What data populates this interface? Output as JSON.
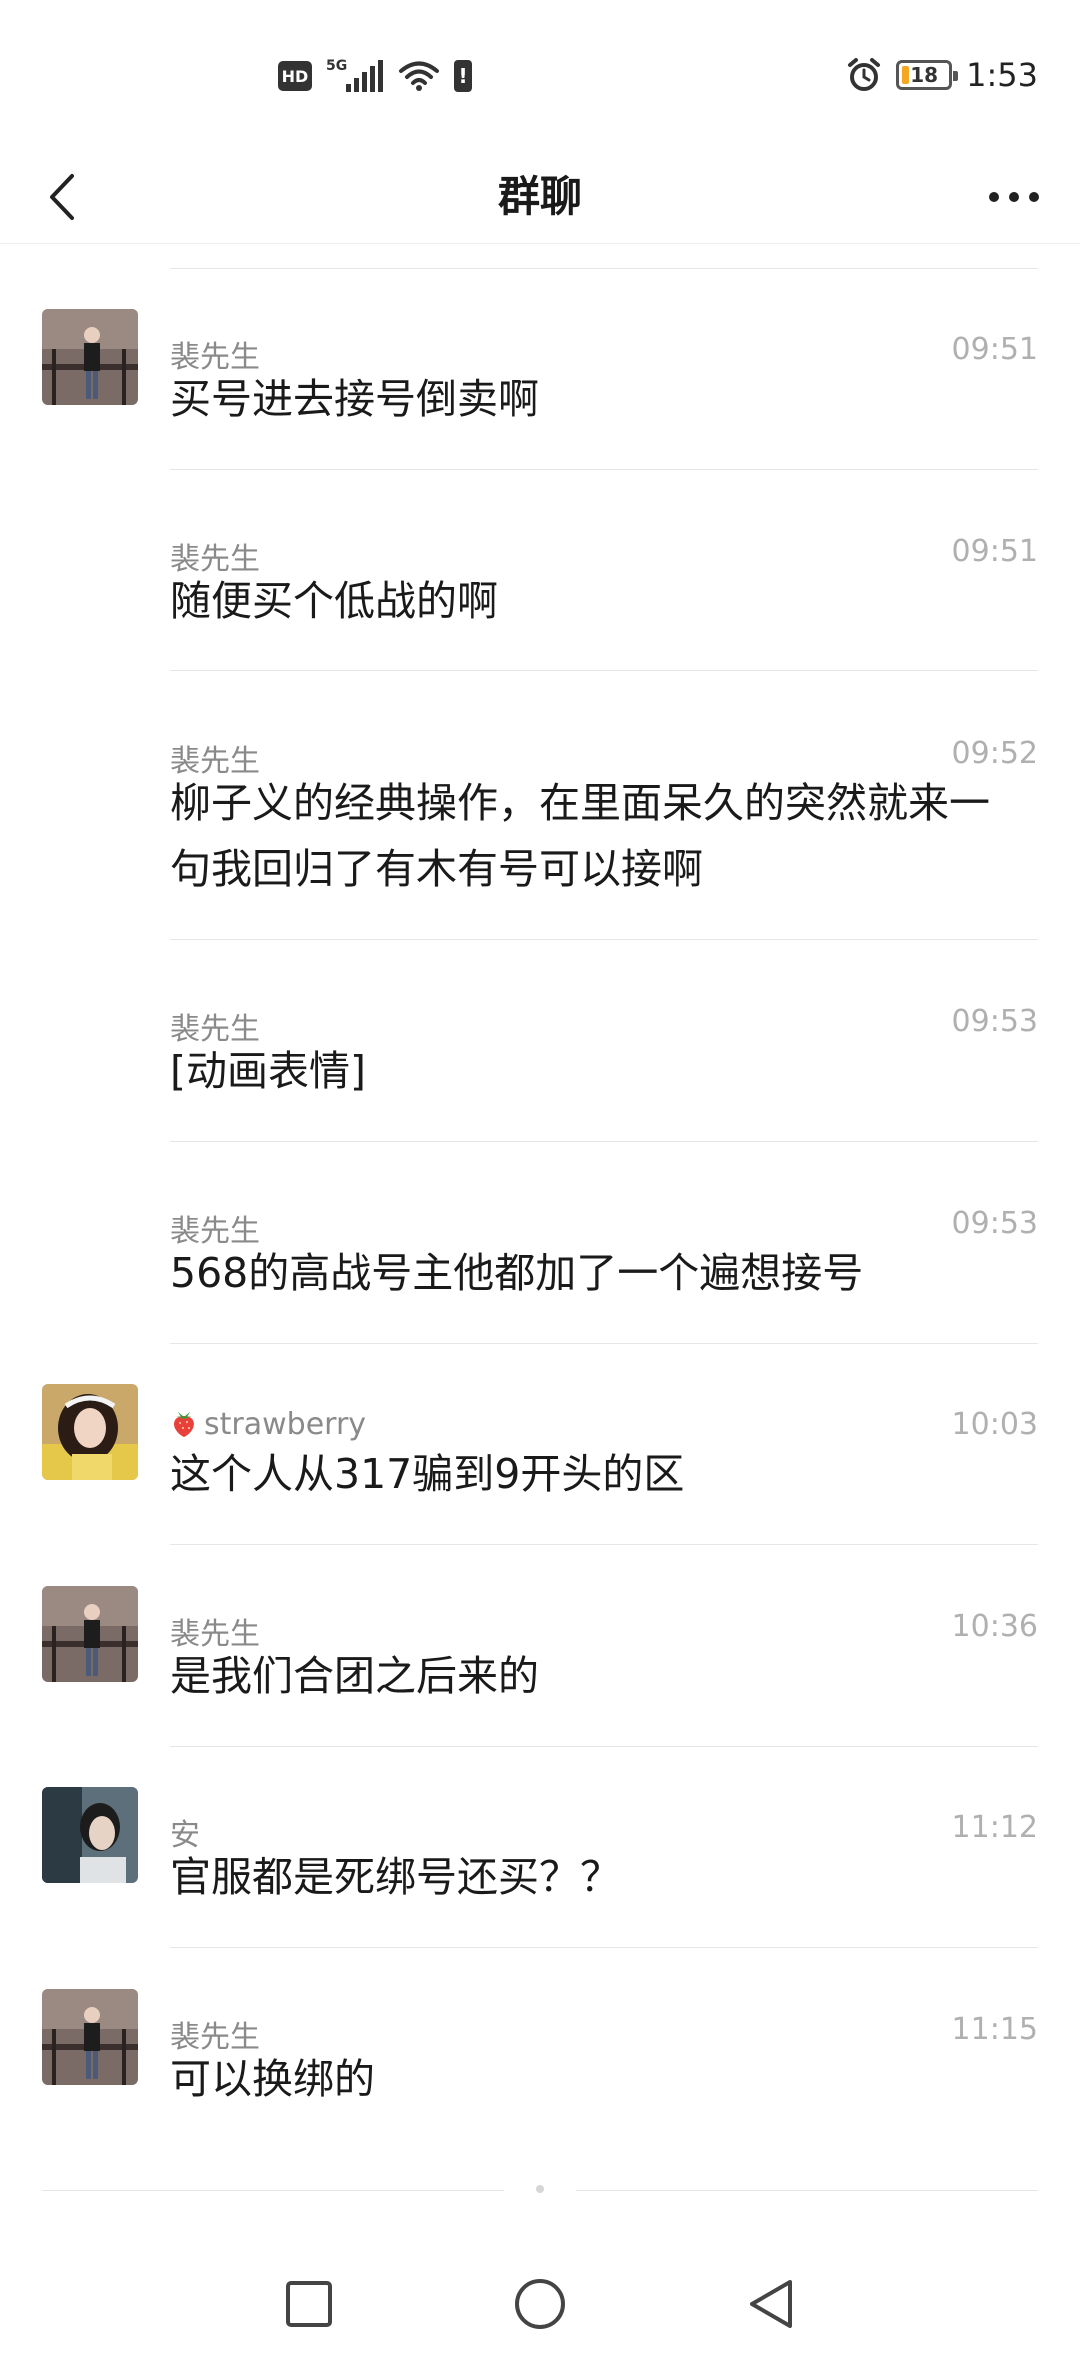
{
  "status_bar": {
    "hd": "HD",
    "network": "5G",
    "battery_level": "18",
    "time": "1:53",
    "icons": [
      "hd-icon",
      "signal-icon",
      "wifi-icon",
      "alert-icon",
      "alarm-icon",
      "battery-icon"
    ]
  },
  "header": {
    "title": "群聊",
    "back_icon": "chevron-left-icon",
    "more_icon": "more-dots-icon"
  },
  "messages": [
    {
      "sender": "裴先生",
      "time": "09:51",
      "text": "买号进去接号倒卖啊",
      "avatar": "avatar-pei"
    },
    {
      "sender": "裴先生",
      "time": "09:51",
      "text": "随便买个低战的啊",
      "avatar": ""
    },
    {
      "sender": "裴先生",
      "time": "09:52",
      "text": "柳子义的经典操作，在里面呆久的突然就来一句我回归了有木有号可以接啊",
      "avatar": ""
    },
    {
      "sender": "裴先生",
      "time": "09:53",
      "text": "[动画表情]",
      "avatar": ""
    },
    {
      "sender": "裴先生",
      "time": "09:53",
      "text": "568的高战号主他都加了一个遍想接号",
      "avatar": ""
    },
    {
      "sender": "strawberry",
      "sender_emoji": "strawberry-icon",
      "time": "10:03",
      "text": "这个人从317骗到9开头的区",
      "avatar": "avatar-strawberry"
    },
    {
      "sender": "裴先生",
      "time": "10:36",
      "text": "是我们合团之后来的",
      "avatar": "avatar-pei"
    },
    {
      "sender": "安",
      "time": "11:12",
      "text": "官服都是死绑号还买？？",
      "avatar": "avatar-an"
    },
    {
      "sender": "裴先生",
      "time": "11:15",
      "text": "可以换绑的",
      "avatar": "avatar-pei"
    }
  ],
  "nav_bar": {
    "icons": [
      "recents-square-icon",
      "home-circle-icon",
      "back-triangle-icon"
    ]
  },
  "colors": {
    "text": "#1a1a1a",
    "meta": "#8a8a8a",
    "time": "#b0b0b0",
    "divider": "#e6e6e6"
  }
}
